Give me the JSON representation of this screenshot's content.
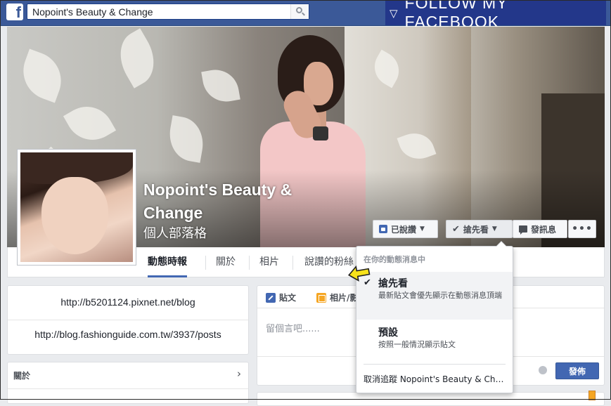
{
  "topbar": {
    "logo": "f",
    "search_value": "Nopoint's Beauty & Change",
    "follow_banner": "FOLLOW MY FACEBOOK"
  },
  "page": {
    "name": "Nopoint's Beauty & Change",
    "category": "個人部落格"
  },
  "cover_buttons": {
    "liked": "已說讚",
    "see_first": "搶先看",
    "message": "發訊息",
    "more": "•••"
  },
  "tabs": [
    "動態時報",
    "關於",
    "相片",
    "說讚的粉絲"
  ],
  "left": {
    "links": [
      "http://b5201124.pixnet.net/blog",
      "http://blog.fashionguide.com.tw/3937/posts"
    ],
    "about_title": "關於"
  },
  "composer": {
    "tab_post": "貼文",
    "tab_photo": "相片/影",
    "placeholder": "留個言吧......",
    "post_button": "發佈"
  },
  "dropdown": {
    "header": "在你的動態消息中",
    "items": [
      {
        "title": "搶先看",
        "desc": "最新貼文會優先顯示在動態消息頂端",
        "selected": true
      },
      {
        "title": "預設",
        "desc": "按照一般情況顯示貼文",
        "selected": false
      }
    ],
    "unfollow": "取消追蹤 Nopoint's Beauty & Change"
  },
  "colors": {
    "facebook_blue": "#3b5998",
    "banner_blue": "#23378a",
    "button_blue": "#4267b2"
  }
}
